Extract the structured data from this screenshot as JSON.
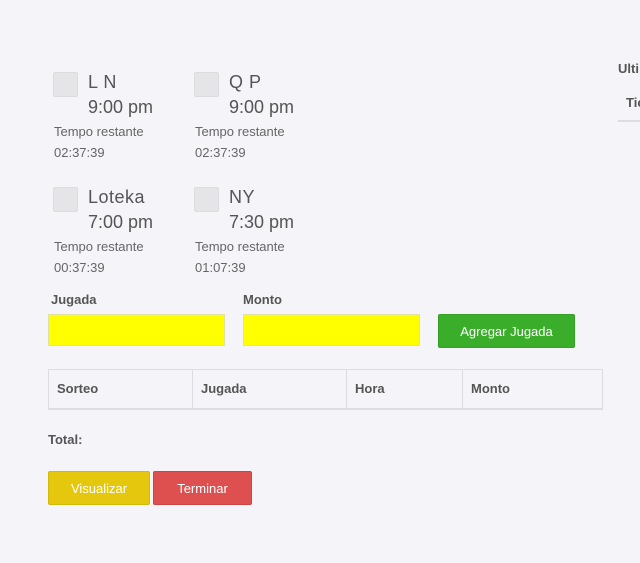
{
  "draws": [
    {
      "name": "L N",
      "time": "9:00 pm",
      "remaining_label": "Tempo restante",
      "remaining": "02:37:39"
    },
    {
      "name": "Q P",
      "time": "9:00 pm",
      "remaining_label": "Tempo restante",
      "remaining": "02:37:39"
    },
    {
      "name": "Loteka",
      "time": "7:00 pm",
      "remaining_label": "Tempo restante",
      "remaining": "00:37:39"
    },
    {
      "name": "NY",
      "time": "7:30 pm",
      "remaining_label": "Tempo restante",
      "remaining": "01:07:39"
    }
  ],
  "form": {
    "jugada_label": "Jugada",
    "jugada_value": "",
    "monto_label": "Monto",
    "monto_value": "",
    "add_button": "Agregar Jugada"
  },
  "table": {
    "columns": [
      "Sorteo",
      "Jugada",
      "Hora",
      "Monto"
    ],
    "rows": []
  },
  "total_label": "Total:",
  "actions": {
    "view_button": "Visualizar",
    "finish_button": "Terminar"
  },
  "side_panel": {
    "title": "Ulti",
    "column": "Tic"
  },
  "colors": {
    "background": "#f4f4f9",
    "input_fill": "#ffff00",
    "add_button": "#3aae2a",
    "view_button": "#e5c80e",
    "finish_button": "#dd504f"
  }
}
